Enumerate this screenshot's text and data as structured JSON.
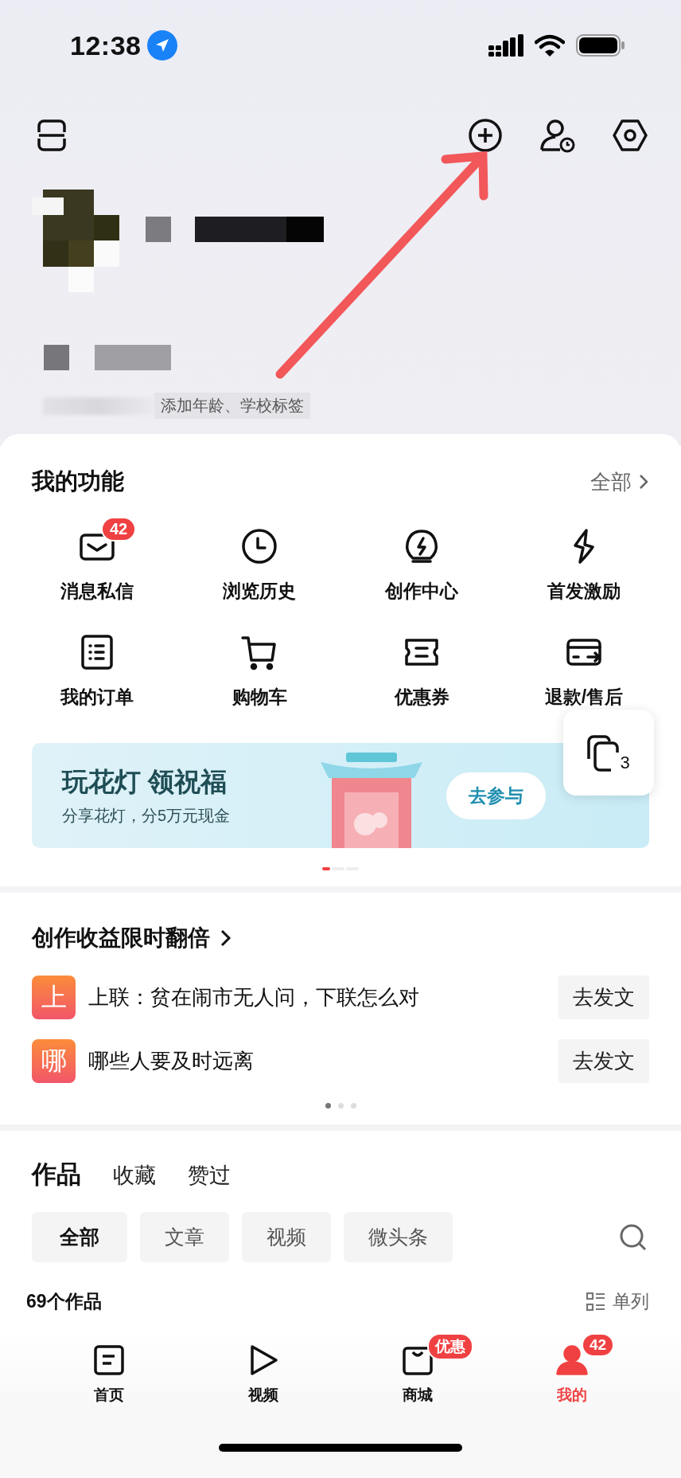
{
  "status_bar": {
    "time": "12:38"
  },
  "profile": {
    "tags_hint": "添加年龄、学校标签"
  },
  "functions": {
    "title": "我的功能",
    "more": "全部",
    "items": [
      {
        "kind": "mail",
        "label": "消息私信",
        "badge": "42"
      },
      {
        "kind": "clock",
        "label": "浏览历史"
      },
      {
        "kind": "bulb",
        "label": "创作中心"
      },
      {
        "kind": "bolt",
        "label": "首发激励"
      },
      {
        "kind": "list",
        "label": "我的订单"
      },
      {
        "kind": "cart",
        "label": "购物车"
      },
      {
        "kind": "ticket",
        "label": "优惠券"
      },
      {
        "kind": "card",
        "label": "退款/售后"
      }
    ]
  },
  "banner": {
    "title": "玩花灯 领祝福",
    "subtitle": "分享花灯，分5万元现金",
    "button": "去参与",
    "pages": [
      {
        "selected": true
      },
      {
        "selected": false
      },
      {
        "selected": false
      }
    ]
  },
  "float_widget": {
    "count": "3"
  },
  "creation": {
    "title": "创作收益限时翻倍",
    "rows": [
      {
        "mark": "上",
        "text": "上联：贫在闹市无人问，下联怎么对",
        "button": "去发文"
      },
      {
        "mark": "哪",
        "text": "哪些人要及时远离",
        "button": "去发文"
      }
    ],
    "pages": [
      {
        "selected": true
      },
      {
        "selected": false
      },
      {
        "selected": false
      }
    ]
  },
  "works": {
    "tabs": [
      {
        "label": "作品",
        "selected": true
      },
      {
        "label": "收藏",
        "selected": false
      },
      {
        "label": "赞过",
        "selected": false
      }
    ],
    "filters": [
      {
        "label": "全部",
        "selected": true
      },
      {
        "label": "文章",
        "selected": false
      },
      {
        "label": "视频",
        "selected": false
      },
      {
        "label": "微头条",
        "selected": false
      }
    ],
    "count": "69个作品",
    "view": "单列"
  },
  "nav": [
    {
      "kind": "home",
      "label": "首页",
      "selected": false
    },
    {
      "kind": "video",
      "label": "视频",
      "selected": false
    },
    {
      "kind": "mall",
      "label": "商城",
      "selected": false,
      "badge": "优惠"
    },
    {
      "kind": "me",
      "label": "我的",
      "selected": true,
      "badge": "42"
    }
  ]
}
